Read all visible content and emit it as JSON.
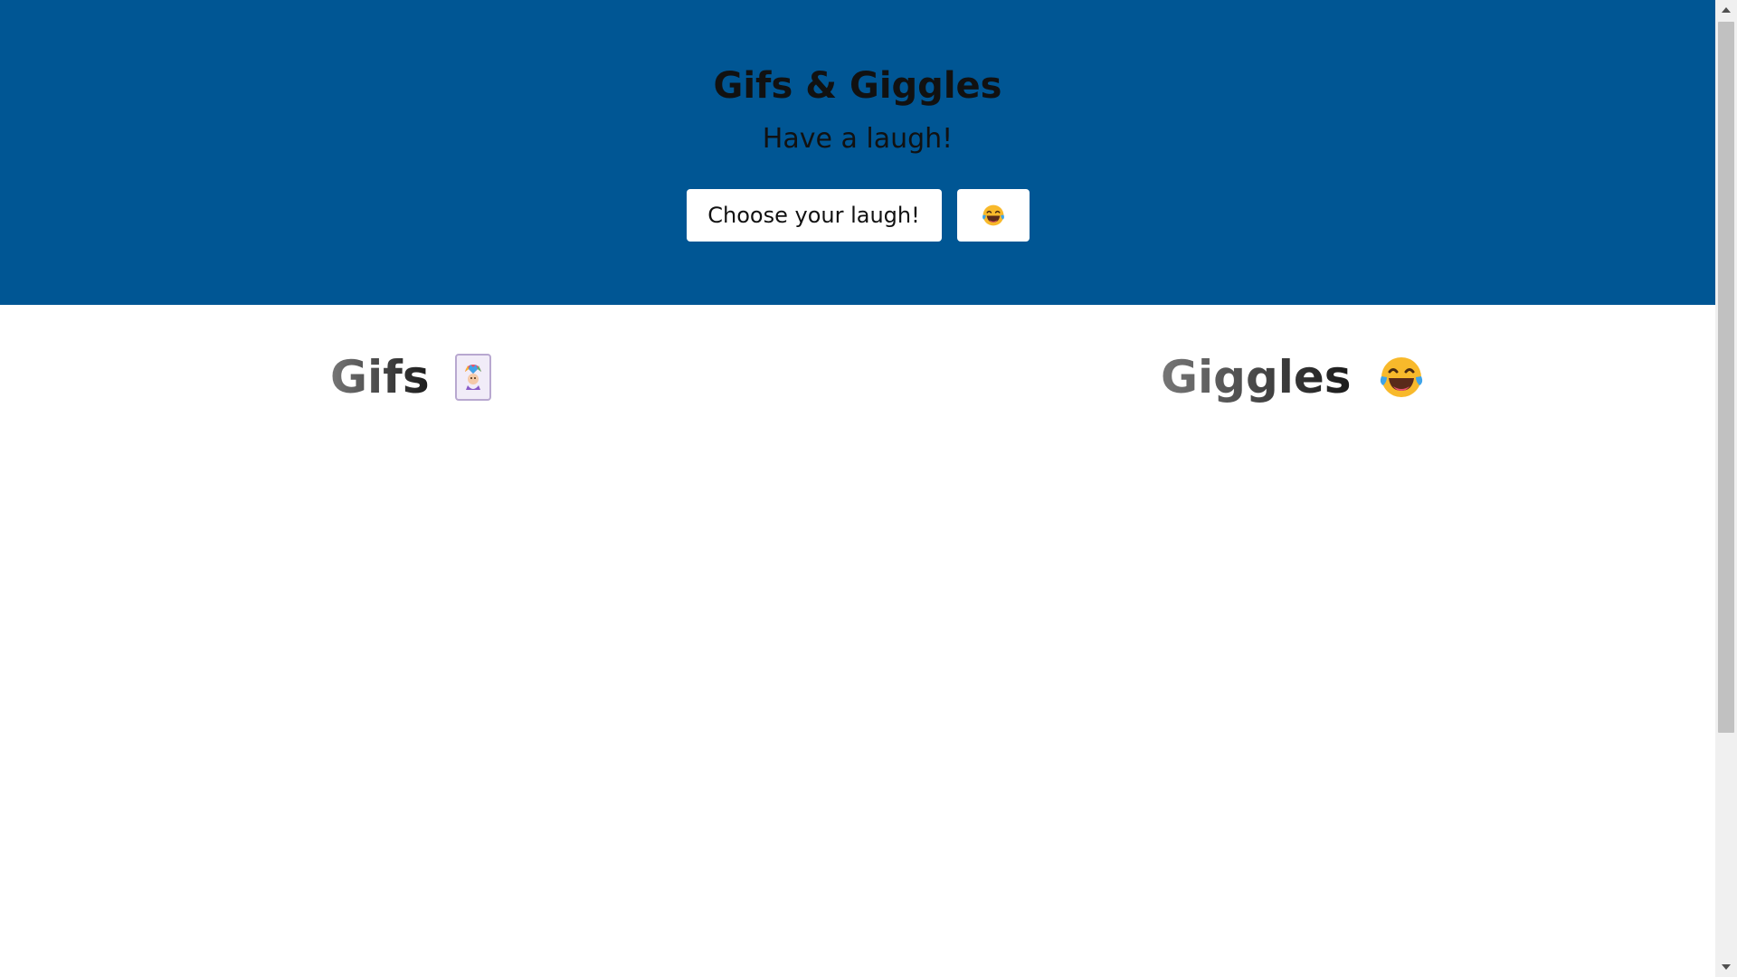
{
  "header": {
    "title": "Gifs & Giggles",
    "subtitle": "Have a laugh!",
    "choose_button_label": "Choose your laugh!",
    "emoji_button_icon": "laughing-face-icon"
  },
  "columns": [
    {
      "title": "Gifs",
      "icon": "joker-card-icon"
    },
    {
      "title": "Giggles",
      "icon": "laughing-face-icon"
    }
  ],
  "colors": {
    "header_background": "#005694",
    "button_background": "#ffffff",
    "scrollbar_track": "#f0f0f0",
    "scrollbar_thumb": "#c1c1c1"
  }
}
